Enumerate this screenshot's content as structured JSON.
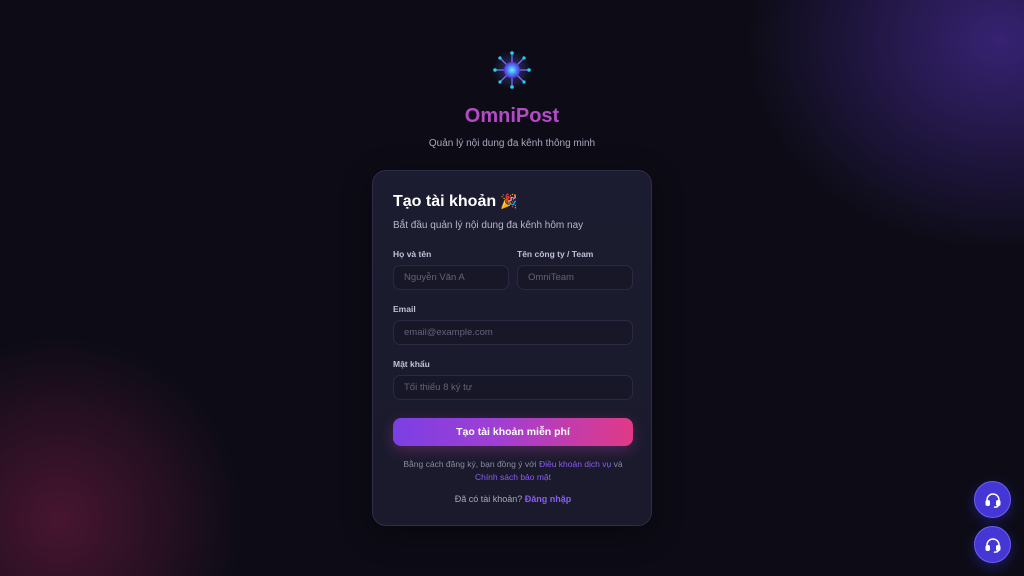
{
  "brand": {
    "name": "OmniPost",
    "tagline": "Quản lý nội dung đa kênh thông minh"
  },
  "signup": {
    "title": "Tạo tài khoản",
    "title_emoji": "🎉",
    "subtitle": "Bắt đầu quản lý nội dung đa kênh hôm nay",
    "fullname": {
      "label": "Họ và tên",
      "placeholder": "Nguyễn Văn A",
      "value": ""
    },
    "company": {
      "label": "Tên công ty / Team",
      "placeholder": "OmniTeam",
      "value": ""
    },
    "email": {
      "label": "Email",
      "placeholder": "email@example.com",
      "value": ""
    },
    "password": {
      "label": "Mật khẩu",
      "placeholder": "Tối thiểu 8 ký tự",
      "value": ""
    },
    "submit_label": "Tạo tài khoản miễn phí",
    "terms_prefix": "Bằng cách đăng ký, bạn đồng ý với",
    "terms_link": "Điều khoản dịch vụ",
    "terms_and": "và",
    "privacy_link": "Chính sách bảo mật",
    "signin_prompt": "Đã có tài khoản?",
    "signin_link": "Đăng nhập"
  },
  "support_buttons": [
    {
      "icon": "headset-icon"
    },
    {
      "icon": "headset-icon"
    }
  ],
  "colors": {
    "background": "#0d0c16",
    "brand": "#b54ac7",
    "accent_link": "#8b5cf6",
    "button_gradient_start": "#7b3fe4",
    "button_gradient_end": "#e03a86",
    "fab": "#4537d6"
  }
}
